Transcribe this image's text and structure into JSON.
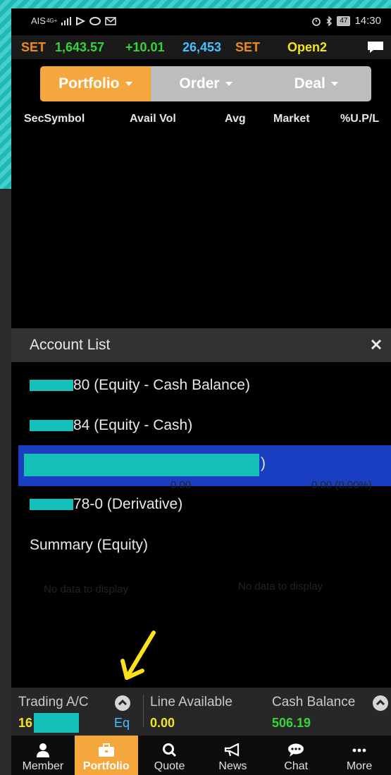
{
  "status_bar": {
    "carrier": "AIS",
    "network": "4G+",
    "battery": "47",
    "time": "14:30"
  },
  "ticker": {
    "market": "SET",
    "index": "1,643.57",
    "change": "+10.01",
    "volume": "26,453",
    "volume_unit": "SET",
    "session": "Open2"
  },
  "tabs": [
    {
      "label": "Portfolio",
      "active": true
    },
    {
      "label": "Order",
      "active": false
    },
    {
      "label": "Deal",
      "active": false
    }
  ],
  "table_headers": [
    "SecSymbol",
    "Avail Vol",
    "Avg",
    "Market",
    "%U.P/L"
  ],
  "background_ghost": {
    "zero_value": "0.00",
    "zero_percent": "0.00 (0.00%)",
    "empty_left": "No data to display",
    "empty_right": "No data to display"
  },
  "account_list": {
    "title": "Account List",
    "items": [
      {
        "suffix": "80 (Equity - Cash Balance)",
        "selected": false
      },
      {
        "suffix": "84 (Equity - Cash)",
        "selected": false
      },
      {
        "suffix": ")",
        "selected": true
      },
      {
        "suffix": "78-0 (Derivative)",
        "selected": false
      },
      {
        "suffix": "Summary (Equity)",
        "selected": false
      }
    ]
  },
  "bottom_info": {
    "trading_label": "Trading A/C",
    "trading_prefix": "16",
    "trading_type": "Eq",
    "line_label": "Line Available",
    "line_value": "0.00",
    "cash_label": "Cash Balance",
    "cash_value": "506.19"
  },
  "nav": [
    {
      "label": "Member",
      "icon": "person-icon",
      "active": false
    },
    {
      "label": "Portfolio",
      "icon": "briefcase-icon",
      "active": true
    },
    {
      "label": "Quote",
      "icon": "search-icon",
      "active": false
    },
    {
      "label": "News",
      "icon": "megaphone-icon",
      "active": false
    },
    {
      "label": "Chat",
      "icon": "chat-bubble-icon",
      "active": false
    },
    {
      "label": "More",
      "icon": "more-icon",
      "active": false
    }
  ],
  "colors": {
    "accent": "#f3a73c",
    "up": "#35d43b",
    "selected": "#1a3ec2",
    "mask": "#15c0b8",
    "annotation": "#ffe11a"
  }
}
